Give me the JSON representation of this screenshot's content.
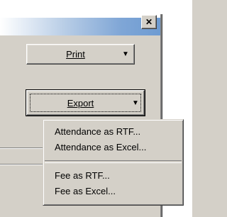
{
  "window": {
    "close_glyph": "✕"
  },
  "buttons": {
    "print": {
      "label": "Print",
      "arrow": "▼"
    },
    "export": {
      "label": "Export",
      "arrow": "▼"
    }
  },
  "export_menu": {
    "items": [
      {
        "label": "Attendance as RTF..."
      },
      {
        "label": "Attendance as Excel..."
      },
      {
        "label": "Fee as RTF..."
      },
      {
        "label": "Fee as Excel..."
      }
    ]
  }
}
